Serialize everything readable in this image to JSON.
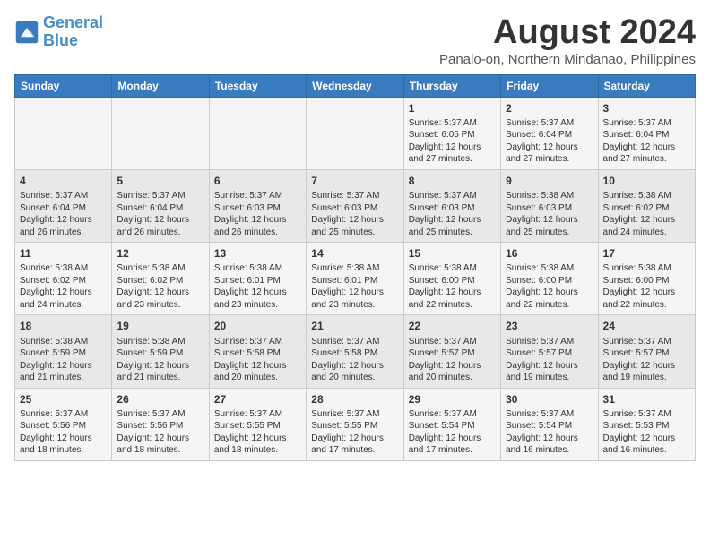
{
  "logo": {
    "text_general": "General",
    "text_blue": "Blue"
  },
  "header": {
    "title": "August 2024",
    "subtitle": "Panalo-on, Northern Mindanao, Philippines"
  },
  "weekdays": [
    "Sunday",
    "Monday",
    "Tuesday",
    "Wednesday",
    "Thursday",
    "Friday",
    "Saturday"
  ],
  "weeks": [
    [
      {
        "day": "",
        "info": ""
      },
      {
        "day": "",
        "info": ""
      },
      {
        "day": "",
        "info": ""
      },
      {
        "day": "",
        "info": ""
      },
      {
        "day": "1",
        "info": "Sunrise: 5:37 AM\nSunset: 6:05 PM\nDaylight: 12 hours and 27 minutes."
      },
      {
        "day": "2",
        "info": "Sunrise: 5:37 AM\nSunset: 6:04 PM\nDaylight: 12 hours and 27 minutes."
      },
      {
        "day": "3",
        "info": "Sunrise: 5:37 AM\nSunset: 6:04 PM\nDaylight: 12 hours and 27 minutes."
      }
    ],
    [
      {
        "day": "4",
        "info": "Sunrise: 5:37 AM\nSunset: 6:04 PM\nDaylight: 12 hours and 26 minutes."
      },
      {
        "day": "5",
        "info": "Sunrise: 5:37 AM\nSunset: 6:04 PM\nDaylight: 12 hours and 26 minutes."
      },
      {
        "day": "6",
        "info": "Sunrise: 5:37 AM\nSunset: 6:03 PM\nDaylight: 12 hours and 26 minutes."
      },
      {
        "day": "7",
        "info": "Sunrise: 5:37 AM\nSunset: 6:03 PM\nDaylight: 12 hours and 25 minutes."
      },
      {
        "day": "8",
        "info": "Sunrise: 5:37 AM\nSunset: 6:03 PM\nDaylight: 12 hours and 25 minutes."
      },
      {
        "day": "9",
        "info": "Sunrise: 5:38 AM\nSunset: 6:03 PM\nDaylight: 12 hours and 25 minutes."
      },
      {
        "day": "10",
        "info": "Sunrise: 5:38 AM\nSunset: 6:02 PM\nDaylight: 12 hours and 24 minutes."
      }
    ],
    [
      {
        "day": "11",
        "info": "Sunrise: 5:38 AM\nSunset: 6:02 PM\nDaylight: 12 hours and 24 minutes."
      },
      {
        "day": "12",
        "info": "Sunrise: 5:38 AM\nSunset: 6:02 PM\nDaylight: 12 hours and 23 minutes."
      },
      {
        "day": "13",
        "info": "Sunrise: 5:38 AM\nSunset: 6:01 PM\nDaylight: 12 hours and 23 minutes."
      },
      {
        "day": "14",
        "info": "Sunrise: 5:38 AM\nSunset: 6:01 PM\nDaylight: 12 hours and 23 minutes."
      },
      {
        "day": "15",
        "info": "Sunrise: 5:38 AM\nSunset: 6:00 PM\nDaylight: 12 hours and 22 minutes."
      },
      {
        "day": "16",
        "info": "Sunrise: 5:38 AM\nSunset: 6:00 PM\nDaylight: 12 hours and 22 minutes."
      },
      {
        "day": "17",
        "info": "Sunrise: 5:38 AM\nSunset: 6:00 PM\nDaylight: 12 hours and 22 minutes."
      }
    ],
    [
      {
        "day": "18",
        "info": "Sunrise: 5:38 AM\nSunset: 5:59 PM\nDaylight: 12 hours and 21 minutes."
      },
      {
        "day": "19",
        "info": "Sunrise: 5:38 AM\nSunset: 5:59 PM\nDaylight: 12 hours and 21 minutes."
      },
      {
        "day": "20",
        "info": "Sunrise: 5:37 AM\nSunset: 5:58 PM\nDaylight: 12 hours and 20 minutes."
      },
      {
        "day": "21",
        "info": "Sunrise: 5:37 AM\nSunset: 5:58 PM\nDaylight: 12 hours and 20 minutes."
      },
      {
        "day": "22",
        "info": "Sunrise: 5:37 AM\nSunset: 5:57 PM\nDaylight: 12 hours and 20 minutes."
      },
      {
        "day": "23",
        "info": "Sunrise: 5:37 AM\nSunset: 5:57 PM\nDaylight: 12 hours and 19 minutes."
      },
      {
        "day": "24",
        "info": "Sunrise: 5:37 AM\nSunset: 5:57 PM\nDaylight: 12 hours and 19 minutes."
      }
    ],
    [
      {
        "day": "25",
        "info": "Sunrise: 5:37 AM\nSunset: 5:56 PM\nDaylight: 12 hours and 18 minutes."
      },
      {
        "day": "26",
        "info": "Sunrise: 5:37 AM\nSunset: 5:56 PM\nDaylight: 12 hours and 18 minutes."
      },
      {
        "day": "27",
        "info": "Sunrise: 5:37 AM\nSunset: 5:55 PM\nDaylight: 12 hours and 18 minutes."
      },
      {
        "day": "28",
        "info": "Sunrise: 5:37 AM\nSunset: 5:55 PM\nDaylight: 12 hours and 17 minutes."
      },
      {
        "day": "29",
        "info": "Sunrise: 5:37 AM\nSunset: 5:54 PM\nDaylight: 12 hours and 17 minutes."
      },
      {
        "day": "30",
        "info": "Sunrise: 5:37 AM\nSunset: 5:54 PM\nDaylight: 12 hours and 16 minutes."
      },
      {
        "day": "31",
        "info": "Sunrise: 5:37 AM\nSunset: 5:53 PM\nDaylight: 12 hours and 16 minutes."
      }
    ]
  ]
}
